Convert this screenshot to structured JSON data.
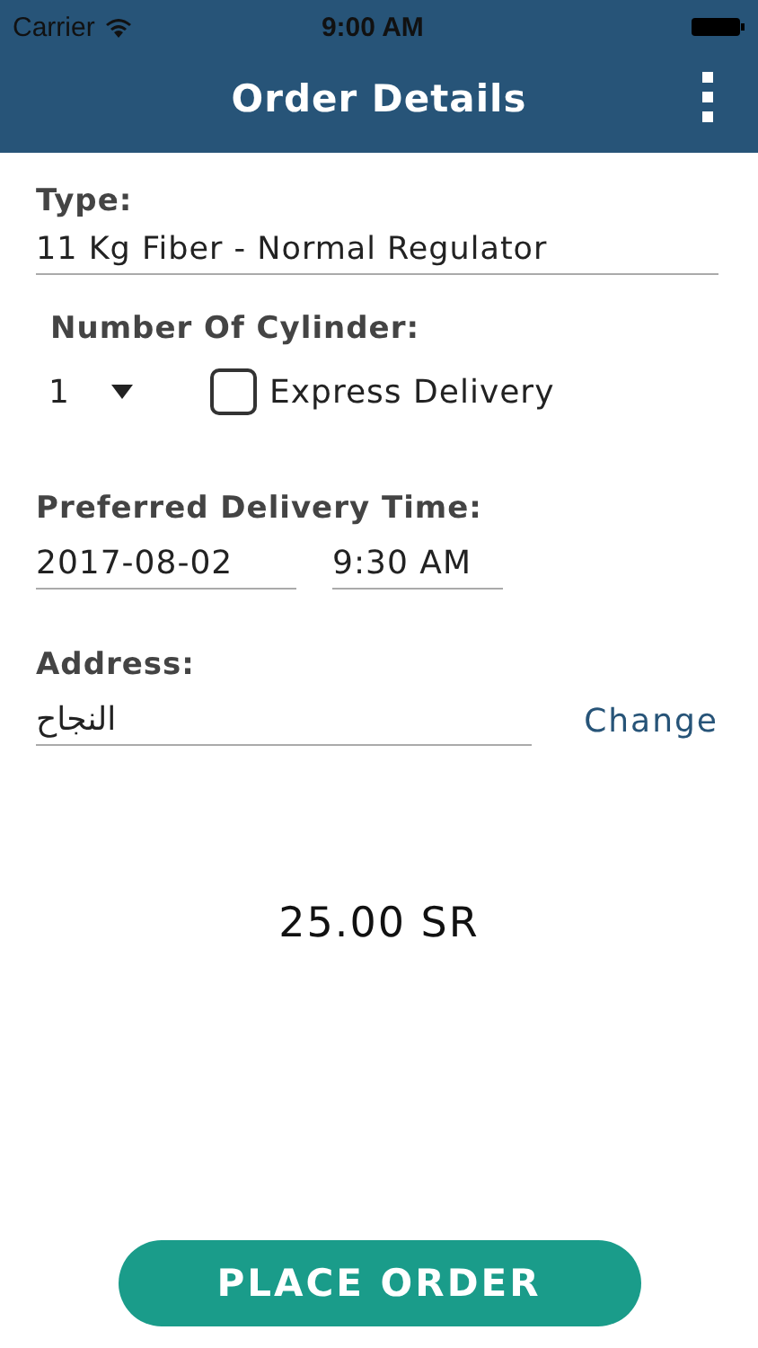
{
  "status_bar": {
    "carrier": "Carrier",
    "time": "9:00 AM"
  },
  "nav_bar": {
    "title": "Order Details"
  },
  "type": {
    "label": "Type:",
    "value": "11 Kg Fiber - Normal Regulator"
  },
  "cylinders": {
    "label": "Number Of Cylinder:",
    "value": "1"
  },
  "express_delivery": {
    "label": "Express Delivery",
    "checked": false
  },
  "delivery_time": {
    "label": "Preferred Delivery Time:",
    "date": "2017-08-02",
    "time": "9:30 AM"
  },
  "address": {
    "label": "Address:",
    "value": "النجاح",
    "change_link": "Change"
  },
  "price": "25.00 SR",
  "place_order_button": "PLACE ORDER"
}
